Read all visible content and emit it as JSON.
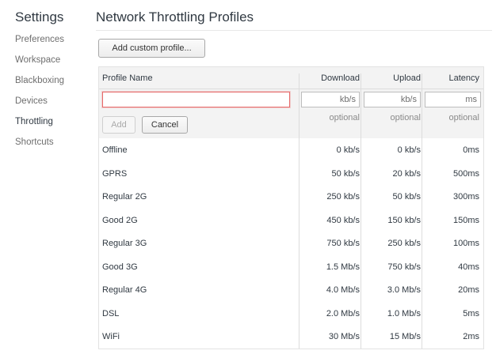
{
  "sidebar": {
    "title": "Settings",
    "items": [
      {
        "label": "Preferences",
        "active": false
      },
      {
        "label": "Workspace",
        "active": false
      },
      {
        "label": "Blackboxing",
        "active": false
      },
      {
        "label": "Devices",
        "active": false
      },
      {
        "label": "Throttling",
        "active": true
      },
      {
        "label": "Shortcuts",
        "active": false
      }
    ]
  },
  "main": {
    "title": "Network Throttling Profiles",
    "add_custom_label": "Add custom profile...",
    "columns": {
      "name": "Profile Name",
      "download": "Download",
      "upload": "Upload",
      "latency": "Latency"
    },
    "editor": {
      "name_value": "",
      "download_placeholder": "kb/s",
      "upload_placeholder": "kb/s",
      "latency_placeholder": "ms",
      "download_hint": "optional",
      "upload_hint": "optional",
      "latency_hint": "optional",
      "add_label": "Add",
      "cancel_label": "Cancel"
    },
    "profiles": [
      {
        "name": "Offline",
        "download": "0 kb/s",
        "upload": "0 kb/s",
        "latency": "0ms"
      },
      {
        "name": "GPRS",
        "download": "50 kb/s",
        "upload": "20 kb/s",
        "latency": "500ms"
      },
      {
        "name": "Regular 2G",
        "download": "250 kb/s",
        "upload": "50 kb/s",
        "latency": "300ms"
      },
      {
        "name": "Good 2G",
        "download": "450 kb/s",
        "upload": "150 kb/s",
        "latency": "150ms"
      },
      {
        "name": "Regular 3G",
        "download": "750 kb/s",
        "upload": "250 kb/s",
        "latency": "100ms"
      },
      {
        "name": "Good 3G",
        "download": "1.5 Mb/s",
        "upload": "750 kb/s",
        "latency": "40ms"
      },
      {
        "name": "Regular 4G",
        "download": "4.0 Mb/s",
        "upload": "3.0 Mb/s",
        "latency": "20ms"
      },
      {
        "name": "DSL",
        "download": "2.0 Mb/s",
        "upload": "1.0 Mb/s",
        "latency": "5ms"
      },
      {
        "name": "WiFi",
        "download": "30 Mb/s",
        "upload": "15 Mb/s",
        "latency": "2ms"
      }
    ]
  }
}
